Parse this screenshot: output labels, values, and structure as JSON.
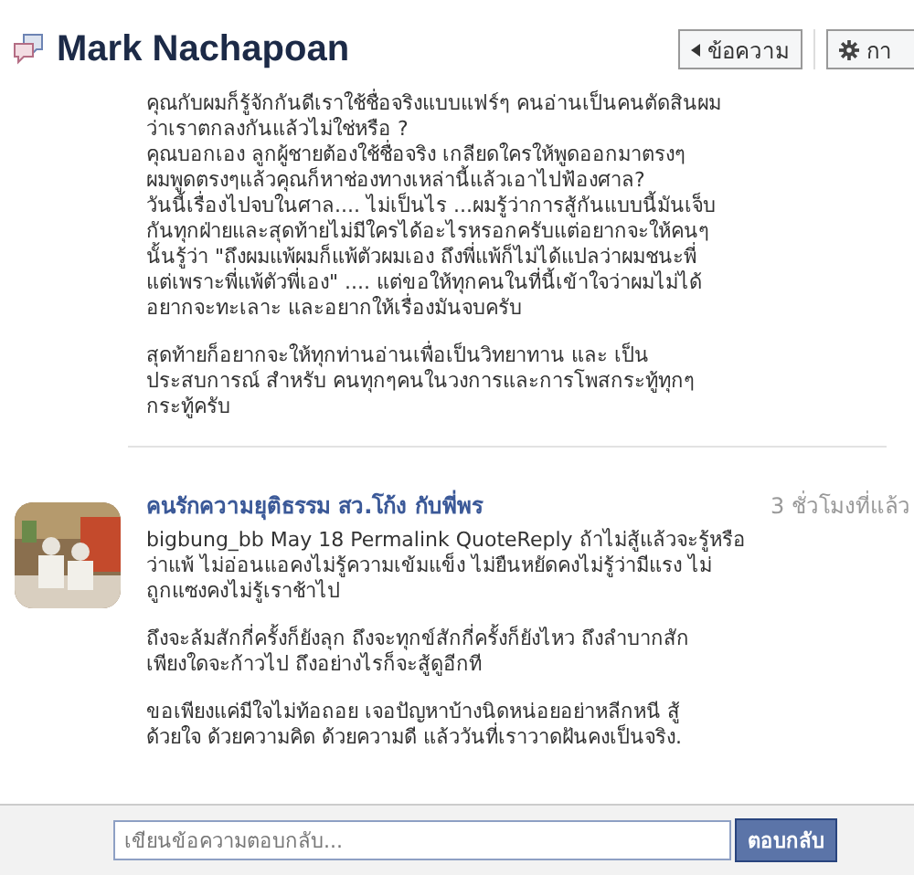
{
  "header": {
    "title": "Mark Nachapoan",
    "buttons": [
      {
        "label": "ข้อความ",
        "kind": "back"
      },
      {
        "label": "กา",
        "kind": "settings"
      }
    ]
  },
  "message": {
    "paragraphs": [
      [
        "คุณกับผมก็รู้จักกันดีเราใช้ชื่อจริงแบบแฟร์ๆ คนอ่านเป็นคนตัดสินผม",
        "ว่าเราตกลงกันแล้วไม่ใช่หรือ ?",
        "คุณบอกเอง ลูกผู้ชายต้องใช้ชื่อจริง เกลียดใครให้พูดออกมาตรงๆ",
        "ผมพูดตรงๆแล้วคุณก็หาช่องทางเหล่านี้แล้วเอาไปฟ้องศาล?",
        "วันนี้เรื่องไปจบในศาล.... ไม่เป็นไร ...ผมรู้ว่าการสู้กันแบบนี้มันเจ็บ",
        "กันทุกฝ่ายและสุดท้ายไม่มีใครได้อะไรหรอกครับแต่อยากจะให้คนๆ",
        "นั้นรู้ว่า \"ถึงผมแพ้ผมก็แพ้ตัวผมเอง ถึงพี่แพ้ก็ไม่ได้แปลว่าผมชนะพี่",
        "แต่เพราะพี่แพ้ตัวพี่เอง\" .... แต่ขอให้ทุกคนในที่นี้เข้าใจว่าผมไม่ได้",
        "อยากจะทะเลาะ และอยากให้เรื่องมันจบครับ"
      ],
      [
        "สุดท้ายก็อยากจะให้ทุกท่านอ่านเพื่อเป็นวิทยาทาน และ เป็น",
        "ประสบการณ์ สำหรับ คนทุกๆคนในวงการและการโพสกระทู้ทุกๆ",
        "กระทู้ครับ"
      ]
    ]
  },
  "comment": {
    "author": "คนรักความยุติธรรม สว.โก้ง กับพี่พร",
    "time": "3 ชั่วโมงที่แล้ว",
    "avatar": {
      "kind": "picture"
    },
    "paragraphs": [
      [
        "bigbung_bb May 18 Permalink QuoteReply ถ้าไม่สู้แล้วจะรู้หรือ",
        "ว่าแพ้ ไม่อ่อนแอคงไม่รู้ความเข้มแข็ง ไม่ยืนหยัดคงไม่รู้ว่ามีแรง ไม่",
        "ถูกแซงคงไม่รู้เราช้าไป"
      ],
      [
        "ถึงจะล้มสักกี่ครั้งก็ยังลุก ถึงจะทุกข์สักกี่ครั้งก็ยังไหว ถึงลำบากสัก",
        "เพียงใดจะก้าวไป ถึงอย่างไรก็จะสู้ดูอีกที"
      ],
      [
        "ขอเพียงแค่มีใจไม่ท้อถอย เจอปัญหาบ้างนิดหน่อยอย่าหลีกหนี สู้",
        "ด้วยใจ ด้วยความคิด ด้วยความดี แล้ววันที่เราวาดฝันคงเป็นจริง."
      ]
    ]
  },
  "reply": {
    "placeholder": "เขียนข้อความตอบกลับ...",
    "button": "ตอบกลับ"
  }
}
